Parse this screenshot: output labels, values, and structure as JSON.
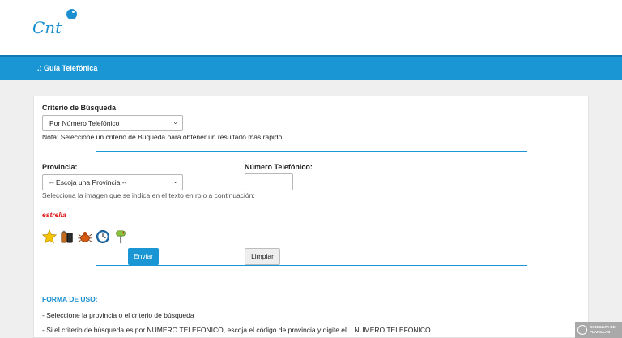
{
  "header": {
    "logo_text": "Cnt"
  },
  "nav": {
    "title": ".: Guía Telefónica"
  },
  "form": {
    "criterio_label": "Criterio de Búsqueda",
    "criterio_value": "Por Número Telefónico",
    "criterio_note": "Nota: Seleccione un criterio de Búqueda para obtener un resultado más rápido.",
    "provincia_label": "Provincia:",
    "provincia_value": "-- Escoja una Provincia --",
    "numero_label": "Número Telefónico:",
    "numero_value": "",
    "captcha_instruction": "Selecciona la imagen que se indica en el texto en rojo a continuación:",
    "captcha_word": "estrella",
    "captcha_icons": [
      "star-icon",
      "battery-icon",
      "bug-icon",
      "clock-icon",
      "mailbox-icon"
    ],
    "send_label": "Enviar",
    "clear_label": "Limpiar"
  },
  "usage": {
    "title": "FORMA DE USO:",
    "line1": "- Seleccione la provincia o el criterio de búsqueda",
    "line2": "- Si el criterio de búsqueda es por NUMERO TELEFONICO, escoja el código de provincia y digite el    NUMERO TELEFONICO"
  },
  "watermark": {
    "text": "CONSULTA DE PLANILLAS"
  },
  "colors": {
    "brand_blue": "#1a96d4",
    "captcha_red": "#dd1111"
  }
}
